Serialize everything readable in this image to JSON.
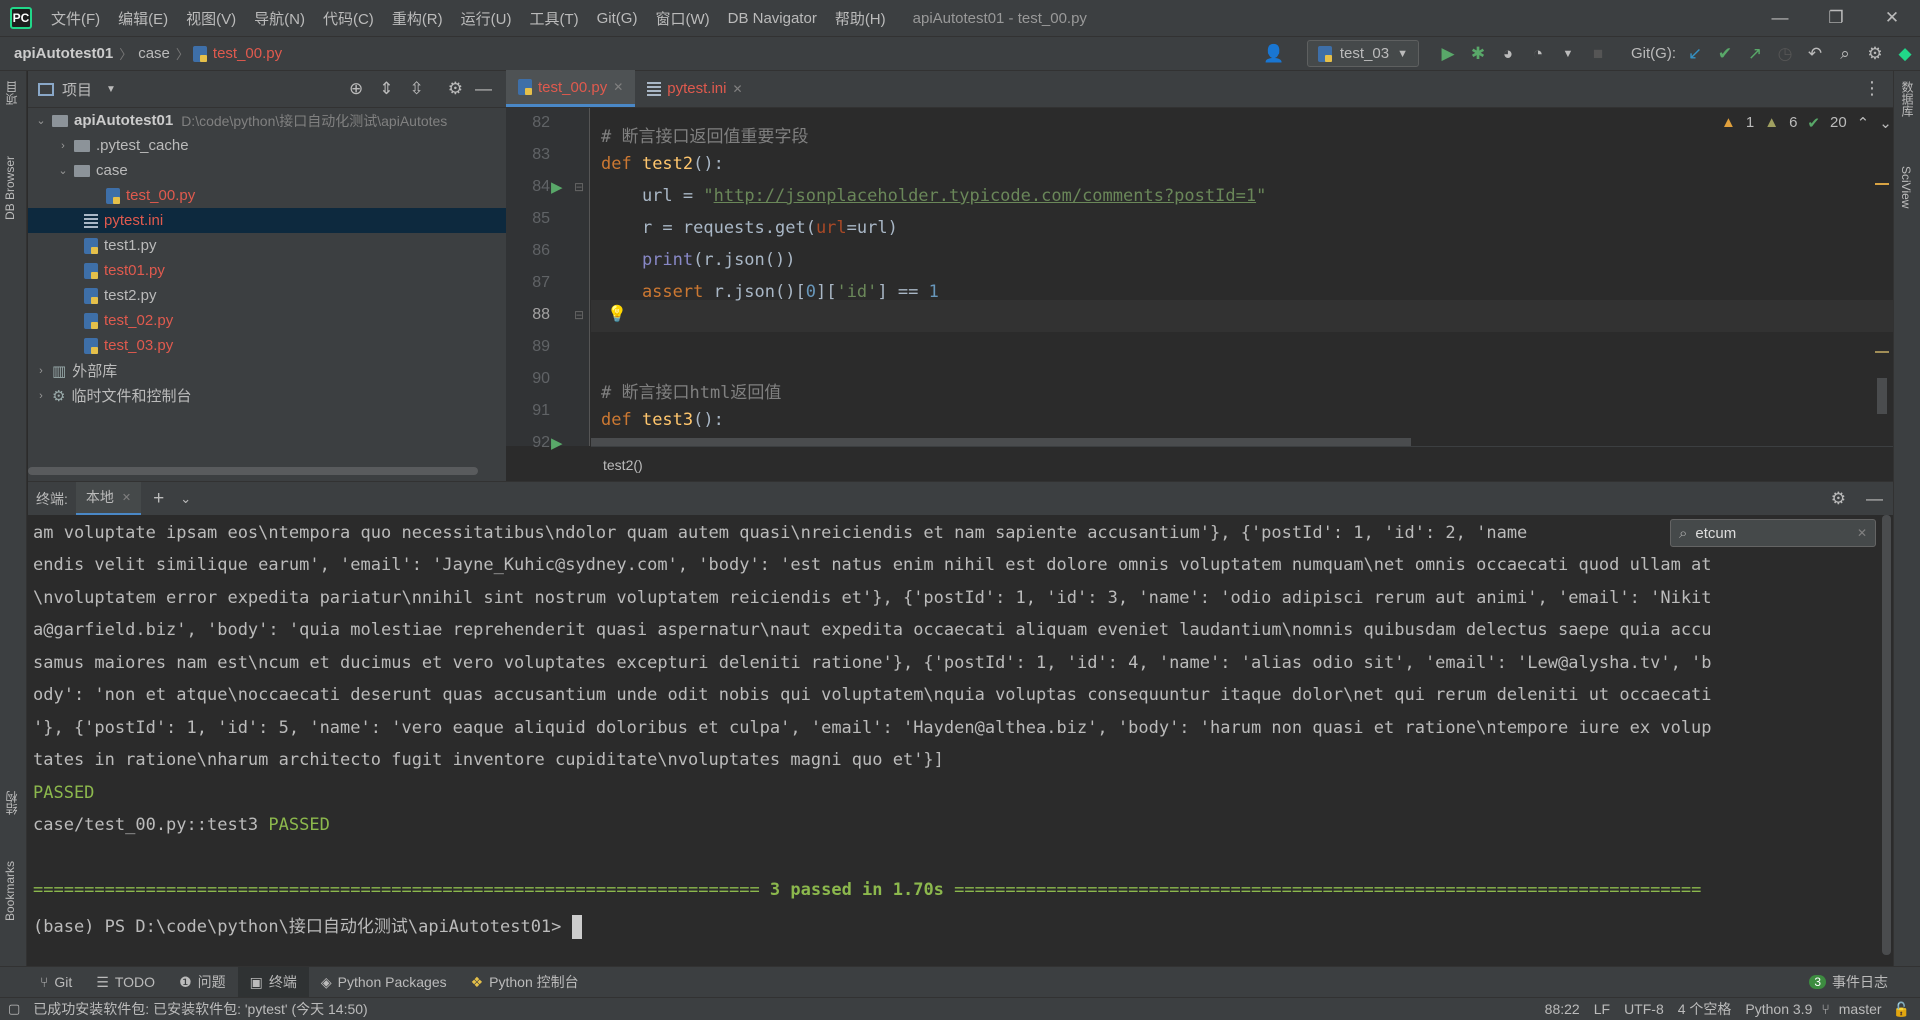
{
  "menu": {
    "items": [
      "文件(F)",
      "编辑(E)",
      "视图(V)",
      "导航(N)",
      "代码(C)",
      "重构(R)",
      "运行(U)",
      "工具(T)",
      "Git(G)",
      "窗口(W)",
      "DB Navigator",
      "帮助(H)"
    ],
    "window_title": "apiAutotest01 - test_00.py"
  },
  "nav": {
    "breadcrumb": [
      "apiAutotest01",
      "case",
      "test_00.py"
    ],
    "run_config": "test_03",
    "git_label": "Git(G):"
  },
  "left_strip": {
    "tabs": [
      "项目",
      "DB Browser",
      "结构",
      "Bookmarks"
    ]
  },
  "right_strip": {
    "tabs": [
      "数据库",
      "SciView"
    ]
  },
  "project": {
    "title": "项目",
    "tree": [
      {
        "label": "apiAutotest01",
        "hint": "D:\\code\\python\\接口自动化测试\\apiAutotes",
        "type": "root"
      },
      {
        "label": ".pytest_cache",
        "type": "folder"
      },
      {
        "label": "case",
        "type": "folder"
      },
      {
        "label": "test_00.py",
        "type": "py"
      },
      {
        "label": "pytest.ini",
        "type": "ini"
      },
      {
        "label": "test1.py",
        "type": "py"
      },
      {
        "label": "test01.py",
        "type": "py"
      },
      {
        "label": "test2.py",
        "type": "py"
      },
      {
        "label": "test_02.py",
        "type": "py"
      },
      {
        "label": "test_03.py",
        "type": "py"
      },
      {
        "label": "外部库",
        "type": "lib"
      },
      {
        "label": "临时文件和控制台",
        "type": "scratch"
      }
    ]
  },
  "editor": {
    "tabs": [
      "test_00.py",
      "pytest.ini"
    ],
    "inspections": {
      "warnings": "1",
      "weak": "6",
      "ok": "20"
    },
    "line_numbers": [
      "82",
      "83",
      "84",
      "85",
      "86",
      "87",
      "88",
      "89",
      "90",
      "91",
      "92"
    ],
    "code": {
      "l83": "# 断言接口返回值重要字段",
      "l84_kw": "def ",
      "l84_fn": "test2",
      "l84_rest": "():",
      "l85_a": "    url = ",
      "l85_q1": "\"",
      "l85_url": "http://jsonplaceholder.typicode.com/comments?postId=1",
      "l85_q2": "\"",
      "l86_a": "    r = requests.get(",
      "l86_param": "url",
      "l86_b": "=url)",
      "l87_bi": "    print",
      "l87_b": "(r.json())",
      "l88_kw": "    assert ",
      "l88_a": "r.json()[",
      "l88_num": "0",
      "l88_b": "][",
      "l88_str": "'id'",
      "l88_c": "] == ",
      "l88_num2": "1",
      "l91": "# 断言接口html返回值",
      "l92_kw": "def ",
      "l92_fn": "test3",
      "l92_rest": "():"
    },
    "breadcrumb": "test2()"
  },
  "terminal": {
    "label": "终端:",
    "tab": "本地",
    "search": "etcum",
    "lines": [
      "am voluptate ipsam eos\\ntempora quo necessitatibus\\ndolor quam autem quasi\\nreiciendis et nam sapiente accusantium'}, {'postId': 1, 'id': 2, 'name",
      "endis velit similique earum', 'email': 'Jayne_Kuhic@sydney.com', 'body': 'est natus enim nihil est dolore omnis voluptatem numquam\\net omnis occaecati quod ullam at",
      "\\nvoluptatem error expedita pariatur\\nnihil sint nostrum voluptatem reiciendis et'}, {'postId': 1, 'id': 3, 'name': 'odio adipisci rerum aut animi', 'email': 'Nikit",
      "a@garfield.biz', 'body': 'quia molestiae reprehenderit quasi aspernatur\\naut expedita occaecati aliquam eveniet laudantium\\nomnis quibusdam delectus saepe quia accu",
      "samus maiores nam est\\ncum et ducimus et vero voluptates excepturi deleniti ratione'}, {'postId': 1, 'id': 4, 'name': 'alias odio sit', 'email': 'Lew@alysha.tv', 'b",
      "ody': 'non et atque\\noccaecati deserunt quas accusantium unde odit nobis qui voluptatem\\nquia voluptas consequuntur itaque dolor\\net qui rerum deleniti ut occaecati",
      "'}, {'postId': 1, 'id': 5, 'name': 'vero eaque aliquid doloribus et culpa', 'email': 'Hayden@althea.biz', 'body': 'harum non quasi et ratione\\ntempore iure ex volup",
      "tates in ratione\\nharum architecto fugit inventore cupiditate\\nvoluptates magni quo et'}]"
    ],
    "passed1": "PASSED",
    "test3": "case/test_00.py::test3 ",
    "passed2": "PASSED",
    "summary_left": "=======================================================================",
    "summary_mid": " 3 passed in 1.70s ",
    "summary_right": "=========================================================================",
    "prompt": "(base) PS D:\\code\\python\\接口自动化测试\\apiAutotest01> "
  },
  "tool_tabs": [
    "Git",
    "TODO",
    "问题",
    "终端",
    "Python Packages",
    "Python 控制台"
  ],
  "event_log": {
    "count": "3",
    "label": "事件日志"
  },
  "status": {
    "message": "已成功安装软件包: 已安装软件包: 'pytest' (今天 14:50)",
    "position": "88:22",
    "line_sep": "LF",
    "encoding": "UTF-8",
    "indent": "4 个空格",
    "interpreter": "Python 3.9",
    "branch": "master"
  }
}
